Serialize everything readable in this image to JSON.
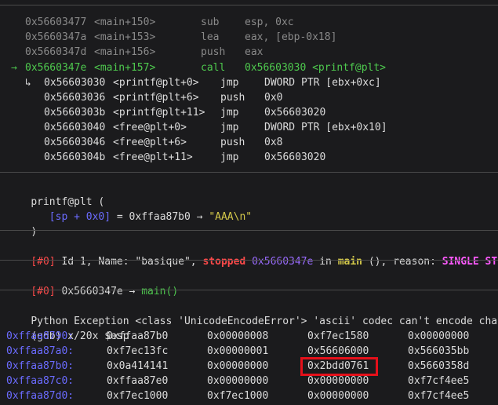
{
  "disasm_prev": [
    {
      "addr": "0x56603477",
      "sym": "<main+150>",
      "mn": "sub",
      "op": "esp, 0xc"
    },
    {
      "addr": "0x5660347a",
      "sym": "<main+153>",
      "mn": "lea",
      "op": "eax, [ebp-0x18]"
    },
    {
      "addr": "0x5660347d",
      "sym": "<main+156>",
      "mn": "push",
      "op": "eax"
    }
  ],
  "disasm_current": {
    "arrow": "→",
    "addr": "0x5660347e",
    "sym": "<main+157>",
    "mn": "call",
    "op": "0x56603030 <printf@plt>"
  },
  "disasm_target": [
    {
      "arrow": "↳",
      "addr": "0x56603030",
      "sym": "<printf@plt+0>",
      "mn": "jmp",
      "op": "DWORD PTR [ebx+0xc]"
    },
    {
      "arrow": "",
      "addr": "0x56603036",
      "sym": "<printf@plt+6>",
      "mn": "push",
      "op": "0x0"
    },
    {
      "arrow": "",
      "addr": "0x5660303b",
      "sym": "<printf@plt+11>",
      "mn": "jmp",
      "op": "0x56603020"
    },
    {
      "arrow": "",
      "addr": "0x56603040",
      "sym": "<free@plt+0>",
      "mn": "jmp",
      "op": "DWORD PTR [ebx+0x10]"
    },
    {
      "arrow": "",
      "addr": "0x56603046",
      "sym": "<free@plt+6>",
      "mn": "push",
      "op": "0x8"
    },
    {
      "arrow": "",
      "addr": "0x5660304b",
      "sym": "<free@plt+11>",
      "mn": "jmp",
      "op": "0x56603020"
    }
  ],
  "args": {
    "func": "printf@plt (",
    "arg_ref": "[sp + 0x0]",
    "arg_eq": " = 0xffaa87b0 → ",
    "arg_val": "\"AAA\\n\"",
    "close": ")"
  },
  "threads": {
    "idx": "[#0]",
    "text1": " Id 1, Name: \"basique\", ",
    "state": "stopped",
    "addr": "0x5660347e",
    "in": " in ",
    "fn": "main",
    "text2": " (), reason: ",
    "reason": "SINGLE STEP"
  },
  "trace": {
    "idx": "[#0]",
    "addr": "0x5660347e → ",
    "fn": "main()"
  },
  "exception": "Python Exception <class 'UnicodeEncodeError'> 'ascii' codec can't encode chara",
  "command": "(gdb) x/20x $esp",
  "memory": [
    {
      "addr": "0xffaa8790:",
      "v": [
        "0xffaa87b0",
        "0x00000008",
        "0xf7ec1580",
        "0x00000000"
      ]
    },
    {
      "addr": "0xffaa87a0:",
      "v": [
        "0xf7ec13fc",
        "0x00000001",
        "0x56606000",
        "0x566035bb"
      ]
    },
    {
      "addr": "0xffaa87b0:",
      "v": [
        "0x0a414141",
        "0x00000000",
        "0x2bdd0761",
        "0x5660358d"
      ]
    },
    {
      "addr": "0xffaa87c0:",
      "v": [
        "0xffaa87e0",
        "0x00000000",
        "0x00000000",
        "0xf7cf4ee5"
      ]
    },
    {
      "addr": "0xffaa87d0:",
      "v": [
        "0xf7ec1000",
        "0xf7ec1000",
        "0x00000000",
        "0xf7cf4ee5"
      ]
    }
  ],
  "colors": {
    "background": "#1b1b1d",
    "current_line": "#4ec94e",
    "address": "#6b6bff",
    "highlight_box": "#e5101a",
    "stopped": "#ff4a4a",
    "reason": "#ff5aff",
    "function": "#d4c94a"
  }
}
